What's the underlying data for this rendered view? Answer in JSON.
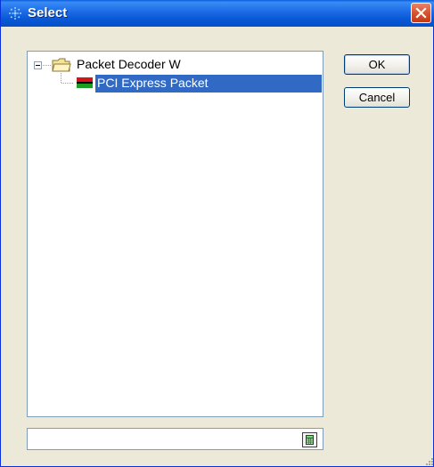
{
  "window": {
    "title": "Select"
  },
  "tree": {
    "root": {
      "label": "Packet Decoder W",
      "icon": "folder-icon"
    },
    "child": {
      "label": "PCI Express Packet",
      "icon": "packet-icon",
      "selected": true
    }
  },
  "buttons": {
    "ok": "OK",
    "cancel": "Cancel"
  },
  "input": {
    "value": ""
  },
  "colors": {
    "title_bar": "#0a58d6",
    "selection": "#316ac5",
    "close": "#d7532f"
  }
}
